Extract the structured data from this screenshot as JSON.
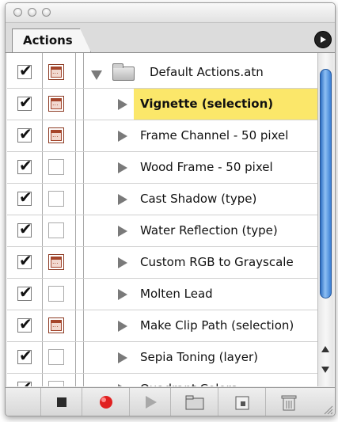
{
  "panel": {
    "tab_label": "Actions"
  },
  "action_set": {
    "name": "Default Actions.atn",
    "checked": true,
    "dialog_on": true,
    "expanded": true
  },
  "actions": [
    {
      "name": "Vignette (selection)",
      "checked": true,
      "dialog_on": true,
      "selected": true
    },
    {
      "name": "Frame Channel - 50 pixel",
      "checked": true,
      "dialog_on": true,
      "selected": false
    },
    {
      "name": "Wood Frame - 50 pixel",
      "checked": true,
      "dialog_on": false,
      "selected": false
    },
    {
      "name": "Cast Shadow (type)",
      "checked": true,
      "dialog_on": false,
      "selected": false
    },
    {
      "name": "Water Reflection (type)",
      "checked": true,
      "dialog_on": false,
      "selected": false
    },
    {
      "name": "Custom RGB to Grayscale",
      "checked": true,
      "dialog_on": true,
      "selected": false
    },
    {
      "name": "Molten Lead",
      "checked": true,
      "dialog_on": false,
      "selected": false
    },
    {
      "name": "Make Clip Path (selection)",
      "checked": true,
      "dialog_on": true,
      "selected": false
    },
    {
      "name": "Sepia Toning (layer)",
      "checked": true,
      "dialog_on": false,
      "selected": false
    },
    {
      "name": "Quadrant Colors",
      "checked": true,
      "dialog_on": false,
      "selected": false
    }
  ],
  "toolbar": {
    "buttons": [
      "stop-icon",
      "record-icon",
      "play-icon",
      "folder-icon",
      "new-action-icon",
      "trash-icon"
    ]
  },
  "colors": {
    "selection": "#fbe76a",
    "record": "#e02020",
    "scroll_thumb": "#4a8fe0"
  }
}
